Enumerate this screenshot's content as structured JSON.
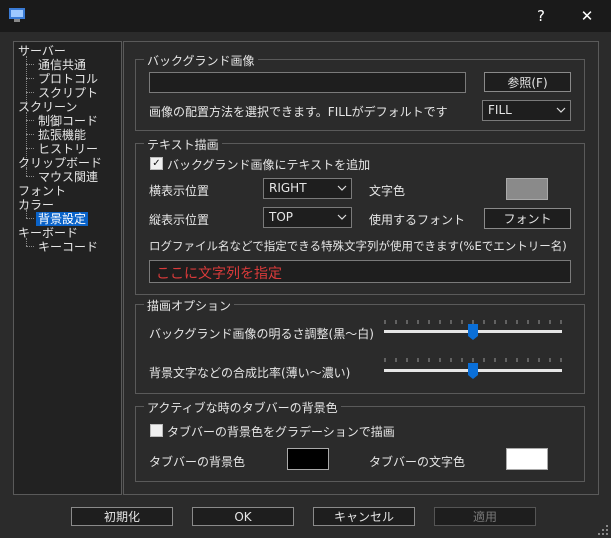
{
  "window": {
    "help_label": "?",
    "close_label": "✕",
    "icon": "app-icon"
  },
  "tree": {
    "items": [
      {
        "label": "サーバー"
      },
      {
        "label": "通信共通"
      },
      {
        "label": "プロトコル"
      },
      {
        "label": "スクリプト"
      },
      {
        "label": "スクリーン"
      },
      {
        "label": "制御コード"
      },
      {
        "label": "拡張機能"
      },
      {
        "label": "ヒストリー"
      },
      {
        "label": "クリップボード"
      },
      {
        "label": "マウス関連"
      },
      {
        "label": "フォント"
      },
      {
        "label": "カラー"
      },
      {
        "label": "背景設定",
        "selected": true
      },
      {
        "label": "キーボード"
      },
      {
        "label": "キーコード"
      }
    ]
  },
  "bg_image": {
    "group_label": "バックグランド画像",
    "path_value": "",
    "browse_label": "参照(F)",
    "placement_label": "画像の配置方法を選択できます。FILLがデフォルトです",
    "placement_value": "FILL"
  },
  "text_draw": {
    "group_label": "テキスト描画",
    "add_text_label": "バックグランド画像にテキストを追加",
    "add_text_checked": true,
    "h_pos_label": "横表示位置",
    "h_pos_value": "RIGHT",
    "text_color_label": "文字色",
    "text_color": "#8a8a8a",
    "v_pos_label": "縦表示位置",
    "v_pos_value": "TOP",
    "font_label": "使用するフォント",
    "font_button_label": "フォント",
    "hint": "ログファイル名などで指定できる特殊文字列が使用できます(%Eでエントリー名)",
    "text_value": "ここに文字列を指定",
    "text_value_color": "#d93a3a"
  },
  "draw_options": {
    "group_label": "描画オプション",
    "brightness_label": "バックグランド画像の明るさ調整(黒～白)",
    "brightness_level": 0.5,
    "blend_label": "背景文字などの合成比率(薄い～濃い)",
    "blend_level": 0.5
  },
  "tab_bar": {
    "group_label": "アクティブな時のタブバーの背景色",
    "gradient_label": "タブバーの背景色をグラデーションで描画",
    "gradient_checked": false,
    "bg_color_label": "タブバーの背景色",
    "bg_color": "#000000",
    "text_color_label": "タブバーの文字色",
    "text_color": "#ffffff"
  },
  "buttons": {
    "reset": "初期化",
    "ok": "OK",
    "cancel": "キャンセル",
    "apply": "適用"
  },
  "colors": {
    "accent": "#0a63c9",
    "background": "#2b2b2b"
  }
}
